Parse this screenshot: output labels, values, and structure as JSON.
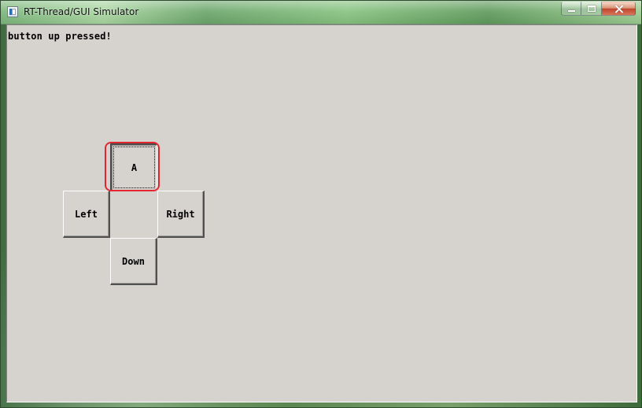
{
  "window": {
    "title": "RT-Thread/GUI Simulator",
    "icon": "app-window-icon",
    "controls": {
      "minimize": "minimize-icon",
      "maximize": "maximize-icon",
      "close": "close-icon"
    }
  },
  "main": {
    "status_text": "button up pressed!",
    "buttons": {
      "up": "A",
      "left": "Left",
      "right": "Right",
      "down": "Down"
    }
  },
  "colors": {
    "window_background": "#d6d3ce",
    "highlight": "#e3262f",
    "close_button": "#c22f1e"
  }
}
